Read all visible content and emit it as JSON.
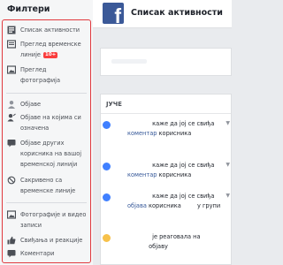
{
  "filters": {
    "title": "Филтери",
    "items": [
      {
        "icon": "news-feed-icon",
        "label": "Списак активности"
      },
      {
        "icon": "timeline-review-icon",
        "label": "Преглед временске линије",
        "badge": "10+"
      },
      {
        "icon": "photo-review-icon",
        "label": "Преглед фотографија"
      },
      {
        "icon": "posts-icon",
        "label": "Објаве"
      },
      {
        "icon": "tagged-icon",
        "label": "Објаве на којима си означена"
      },
      {
        "icon": "others-posts-icon",
        "label": "Објаве других корисника на вашој временској линији"
      },
      {
        "icon": "hidden-icon",
        "label": "Сакривено са временске линије"
      },
      {
        "icon": "photos-icon",
        "label": "Фотографије и видео записи"
      },
      {
        "icon": "likes-icon",
        "label": "Свиђања и реакције"
      },
      {
        "icon": "comments-icon",
        "label": "Коментари"
      }
    ]
  },
  "header": {
    "logo": "f",
    "title": "Списак активности"
  },
  "activity": {
    "section_label": "ЈУЧЕ",
    "entries": [
      {
        "icon": "like-icon",
        "line1": "каже да јој се свиђа",
        "line2_link": "коментар",
        "line2_rest": "корисника"
      },
      {
        "icon": "like-icon",
        "line1": "каже да јој се свиђа",
        "line2_link": "коментар",
        "line2_rest": "корисника"
      },
      {
        "icon": "like-icon",
        "line1": "каже да јој се свиђа",
        "line2_link": "објава",
        "line2_rest": "корисника",
        "line2_tail": "у групи"
      },
      {
        "icon": "reaction-icon",
        "line1": "је реаговала на",
        "line2_link": "",
        "line2_rest": "објаву"
      }
    ]
  },
  "colors": {
    "accent": "#3b5998",
    "highlight": "#e0393e",
    "like": "#4080ff"
  }
}
